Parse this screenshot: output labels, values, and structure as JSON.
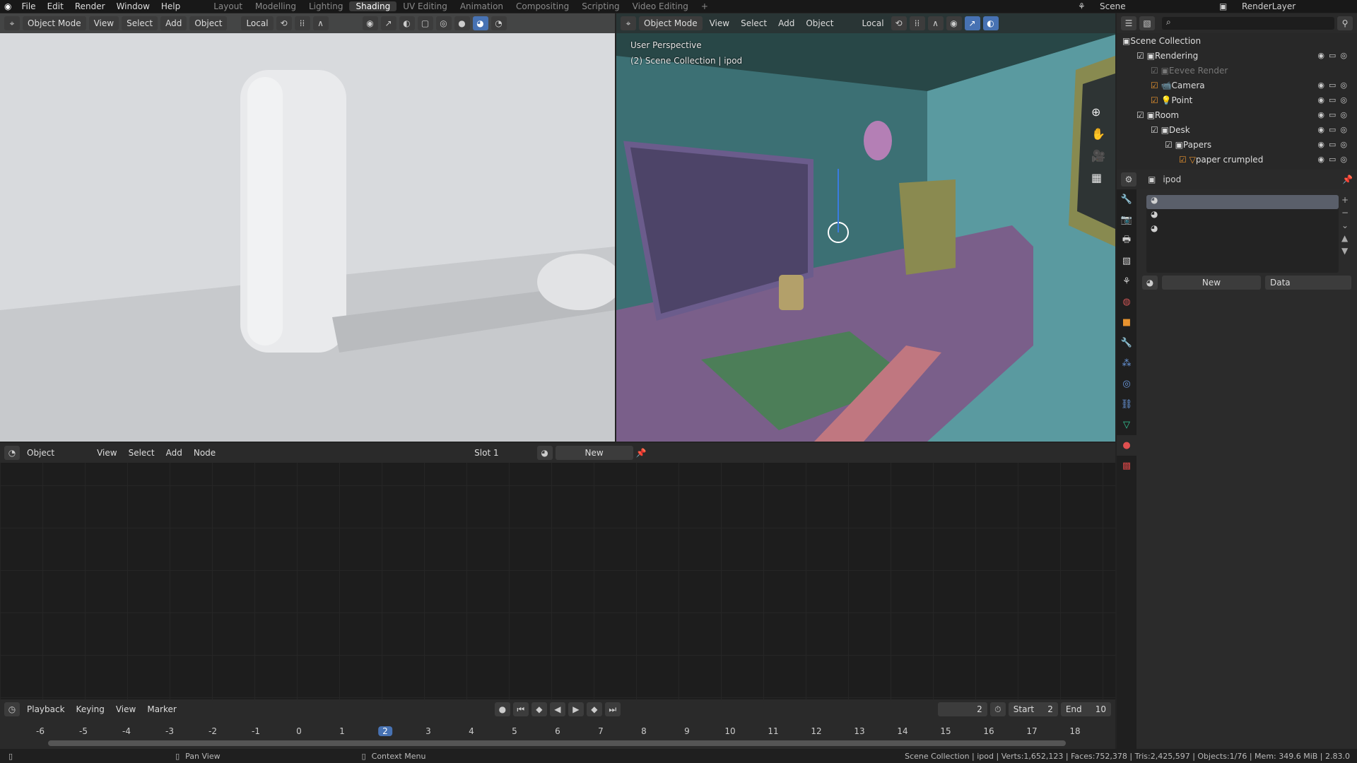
{
  "menu": [
    "File",
    "Edit",
    "Render",
    "Window",
    "Help"
  ],
  "workspaces": [
    "Layout",
    "Modelling",
    "Lighting",
    "Shading",
    "UV Editing",
    "Animation",
    "Compositing",
    "Scripting",
    "Video Editing"
  ],
  "active_workspace": "Shading",
  "scene": "Scene",
  "view_layer": "RenderLayer",
  "left_vp": {
    "mode": "Object Mode",
    "menus": [
      "View",
      "Select",
      "Add",
      "Object"
    ],
    "orientation": "Local"
  },
  "right_vp": {
    "mode": "Object Mode",
    "menus": [
      "View",
      "Select",
      "Add",
      "Object"
    ],
    "orientation": "Local",
    "overlay1": "User Perspective",
    "overlay2": "(2) Scene Collection | ipod"
  },
  "outliner": {
    "items": [
      {
        "label": "Scene Collection",
        "indent": 0
      },
      {
        "label": "Rendering",
        "indent": 1
      },
      {
        "label": "Eevee Render",
        "indent": 2
      },
      {
        "label": "Camera",
        "indent": 2
      },
      {
        "label": "Point",
        "indent": 2
      },
      {
        "label": "Room",
        "indent": 1
      },
      {
        "label": "Desk",
        "indent": 2
      },
      {
        "label": "Papers",
        "indent": 3
      },
      {
        "label": "paper crumpled",
        "indent": 4
      }
    ]
  },
  "properties": {
    "object": "ipod",
    "new_label": "New",
    "link": "Data"
  },
  "node_editor": {
    "mode": "Object",
    "menus": [
      "View",
      "Select",
      "Add",
      "Node"
    ],
    "slot": "Slot 1",
    "new_label": "New"
  },
  "timeline": {
    "menus": [
      "Playback",
      "Keying",
      "View",
      "Marker"
    ],
    "current_frame": "2",
    "start_label": "Start",
    "start": "2",
    "end_label": "End",
    "end": "10",
    "ticks": [
      "-6",
      "-5",
      "-4",
      "-3",
      "-2",
      "-1",
      "0",
      "1",
      "2",
      "3",
      "4",
      "5",
      "6",
      "7",
      "8",
      "9",
      "10",
      "11",
      "12",
      "13",
      "14",
      "15",
      "16",
      "17",
      "18"
    ]
  },
  "status": {
    "hint1": "Pan View",
    "hint2": "Context Menu",
    "stats": "Scene Collection | ipod | Verts:1,652,123 | Faces:752,378 | Tris:2,425,597 | Objects:1/76 | Mem: 349.6 MiB | 2.83.0"
  }
}
